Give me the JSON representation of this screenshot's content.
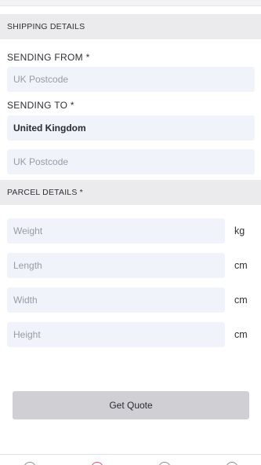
{
  "shipping": {
    "header": "SHIPPING DETAILS",
    "from_label": "SENDING FROM *",
    "from_placeholder": "UK Postcode",
    "to_label": "SENDING TO *",
    "to_country": "United Kingdom",
    "to_placeholder": "UK Postcode"
  },
  "parcel": {
    "header": "PARCEL DETAILS *",
    "fields": [
      {
        "placeholder": "Weight",
        "unit": "kg"
      },
      {
        "placeholder": "Length",
        "unit": "cm"
      },
      {
        "placeholder": "Width",
        "unit": "cm"
      },
      {
        "placeholder": "Height",
        "unit": "cm"
      }
    ]
  },
  "actions": {
    "get_quote_label": "Get Quote"
  },
  "bottom_nav": {
    "icons": [
      "nav-icon-1",
      "nav-icon-2",
      "nav-icon-3",
      "nav-icon-4"
    ],
    "active_color": "#e2506a"
  }
}
